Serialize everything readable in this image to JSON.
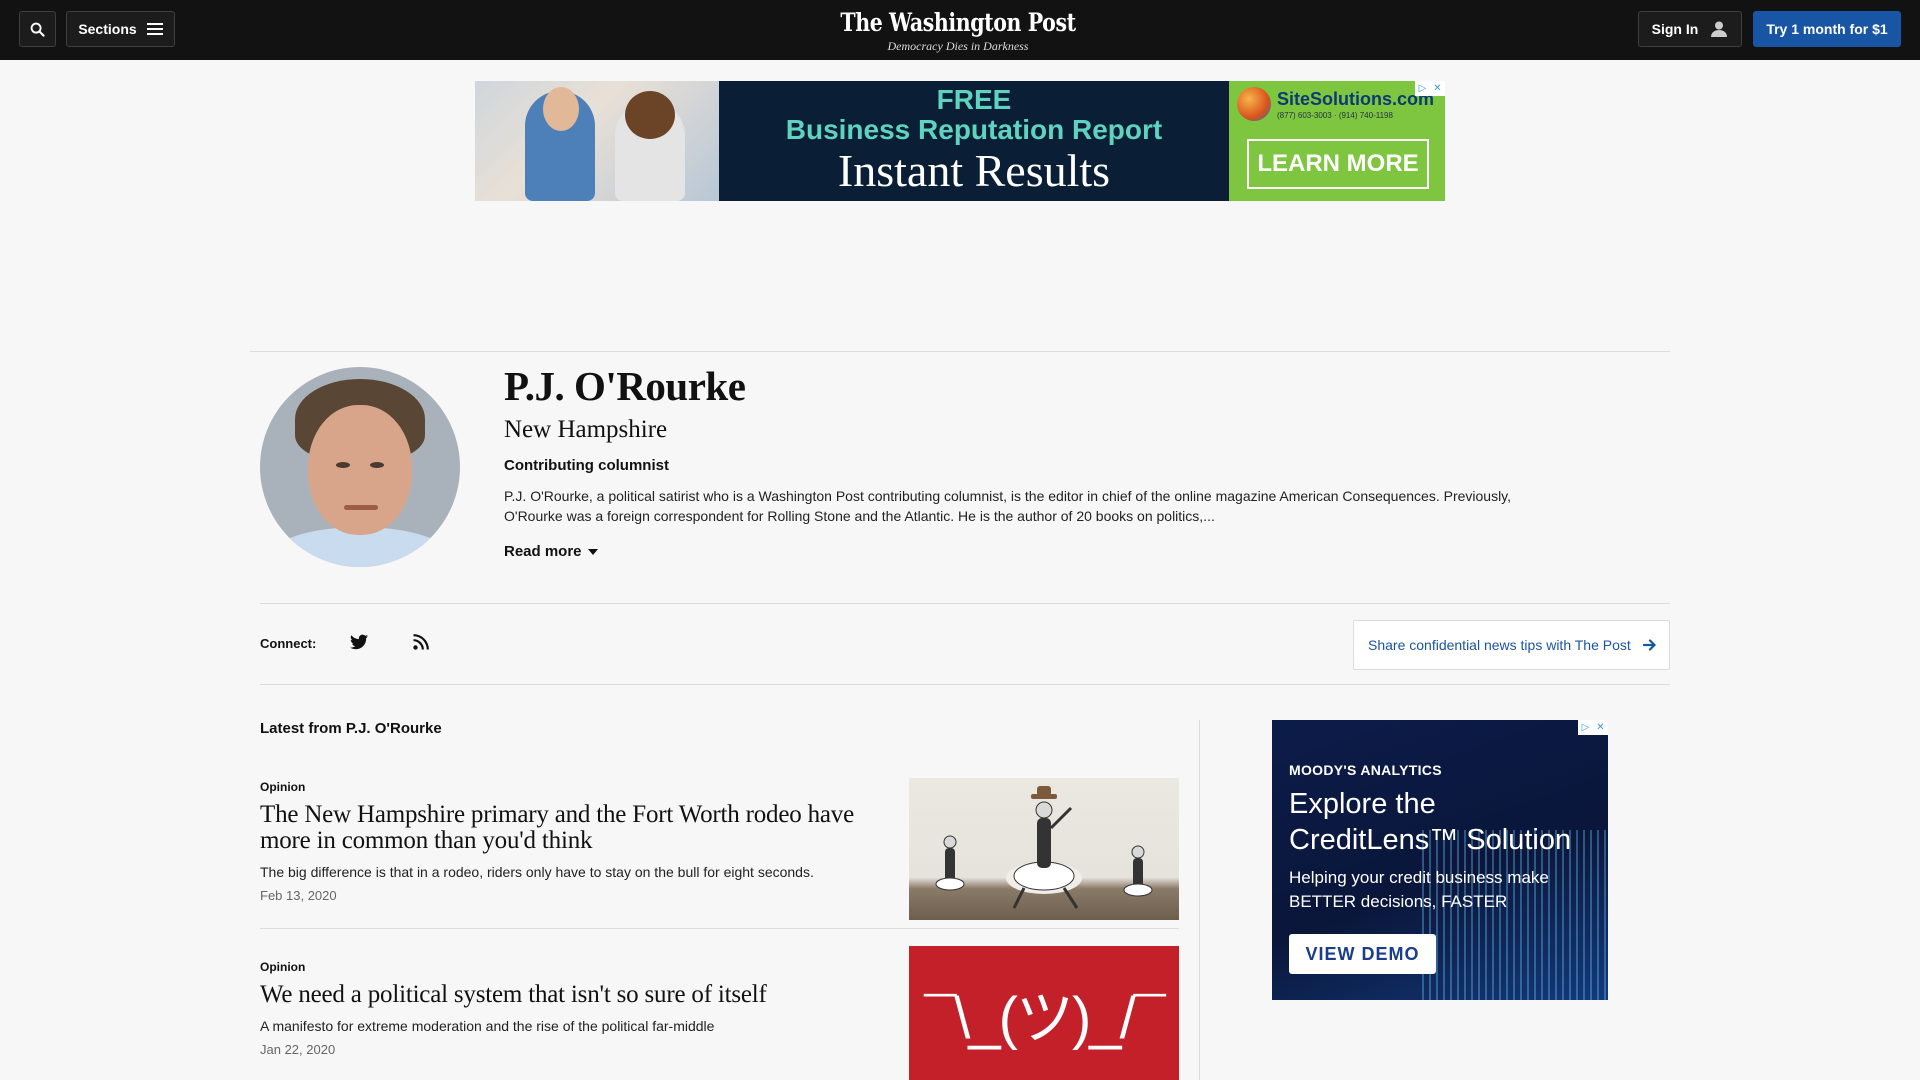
{
  "header": {
    "sections_label": "Sections",
    "masthead": "The Washington Post",
    "tagline": "Democracy Dies in Darkness",
    "signin_label": "Sign In",
    "trial_label": "Try 1 month for $1"
  },
  "ad_top": {
    "line1": "FREE",
    "line2": "Business Reputation Report",
    "line3": "Instant Results",
    "brand": "SiteSolutions.com",
    "phone": "(877) 603-3003 · (914) 740-1198",
    "cta": "LEARN MORE"
  },
  "author": {
    "name": "P.J. O'Rourke",
    "location": "New Hampshire",
    "role": "Contributing columnist",
    "bio": "P.J. O'Rourke, a political satirist who is a Washington Post contributing columnist, is the editor in chief of the online magazine American Consequences. Previously, O'Rourke was a foreign correspondent for Rolling Stone and the Atlantic. He is the author of 20 books on politics,...",
    "read_more": "Read more"
  },
  "connect": {
    "label": "Connect:",
    "tips": "Share confidential news tips with The Post"
  },
  "latest": {
    "heading": "Latest from P.J. O'Rourke",
    "articles": [
      {
        "kicker": "Opinion",
        "headline": "The New Hampshire primary and the Fort Worth rodeo have more in common than you'd think",
        "blurb": "The big difference is that in a rodeo, riders only have to stay on the bull for eight seconds.",
        "date": "Feb 13, 2020"
      },
      {
        "kicker": "Opinion",
        "headline": "We need a political system that isn't so sure of itself",
        "blurb": "A manifesto for extreme moderation and the rise of the political far-middle",
        "date": "Jan 22, 2020",
        "thumb_text": "¯\\_(ツ)_/¯"
      }
    ]
  },
  "ad_side": {
    "company": "MOODY'S ANALYTICS",
    "headline": "Explore the CreditLens™ Solution",
    "sub": "Helping your credit business make BETTER decisions, FASTER",
    "cta": "VIEW DEMO"
  },
  "colors": {
    "topbar": "#121212",
    "accent_blue": "#1955a5",
    "background": "#f7f7f7"
  }
}
